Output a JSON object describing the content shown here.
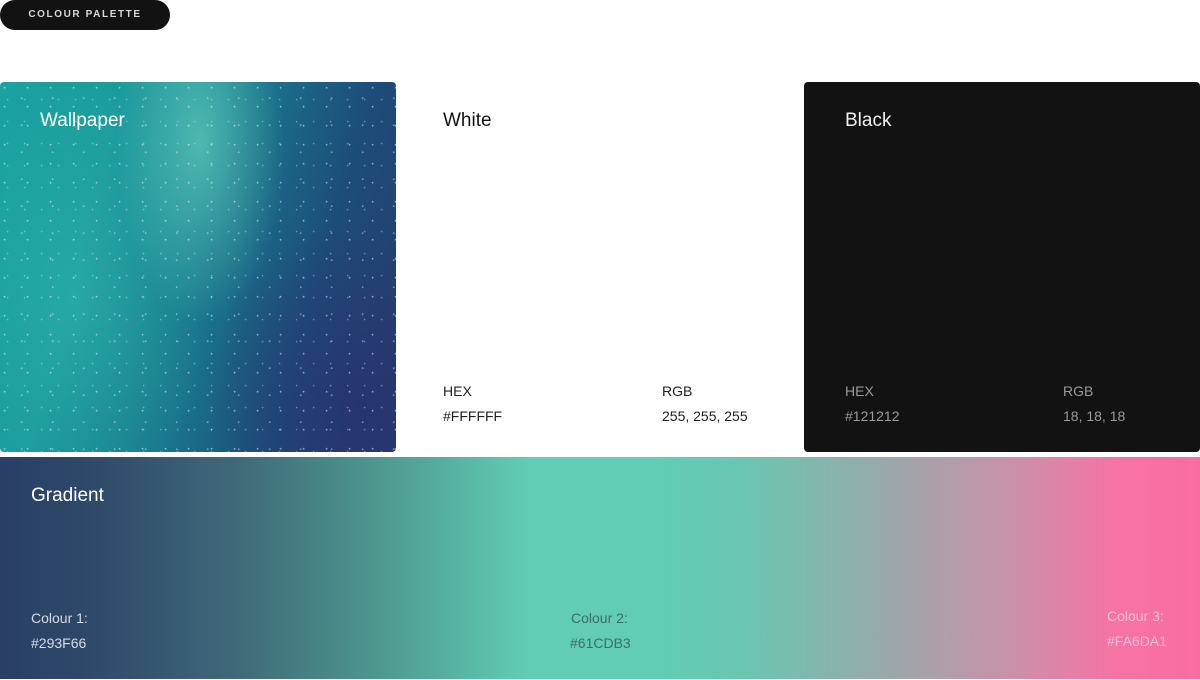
{
  "header": {
    "pill_label": "COLOUR PALETTE"
  },
  "cards": {
    "wallpaper": {
      "title": "Wallpaper"
    },
    "white": {
      "title": "White",
      "hex_label": "HEX",
      "hex_value": "#FFFFFF",
      "rgb_label": "RGB",
      "rgb_value": "255, 255, 255",
      "color": "#FFFFFF"
    },
    "black": {
      "title": "Black",
      "hex_label": "HEX",
      "hex_value": "#121212",
      "rgb_label": "RGB",
      "rgb_value": "18, 18, 18",
      "color": "#121212"
    }
  },
  "gradient": {
    "title": "Gradient",
    "colours": [
      {
        "label": "Colour 1:",
        "hex": "#293F66"
      },
      {
        "label": "Colour 2:",
        "hex": "#61CDB3"
      },
      {
        "label": "Colour 3:",
        "hex": "#FA6DA1"
      }
    ]
  }
}
